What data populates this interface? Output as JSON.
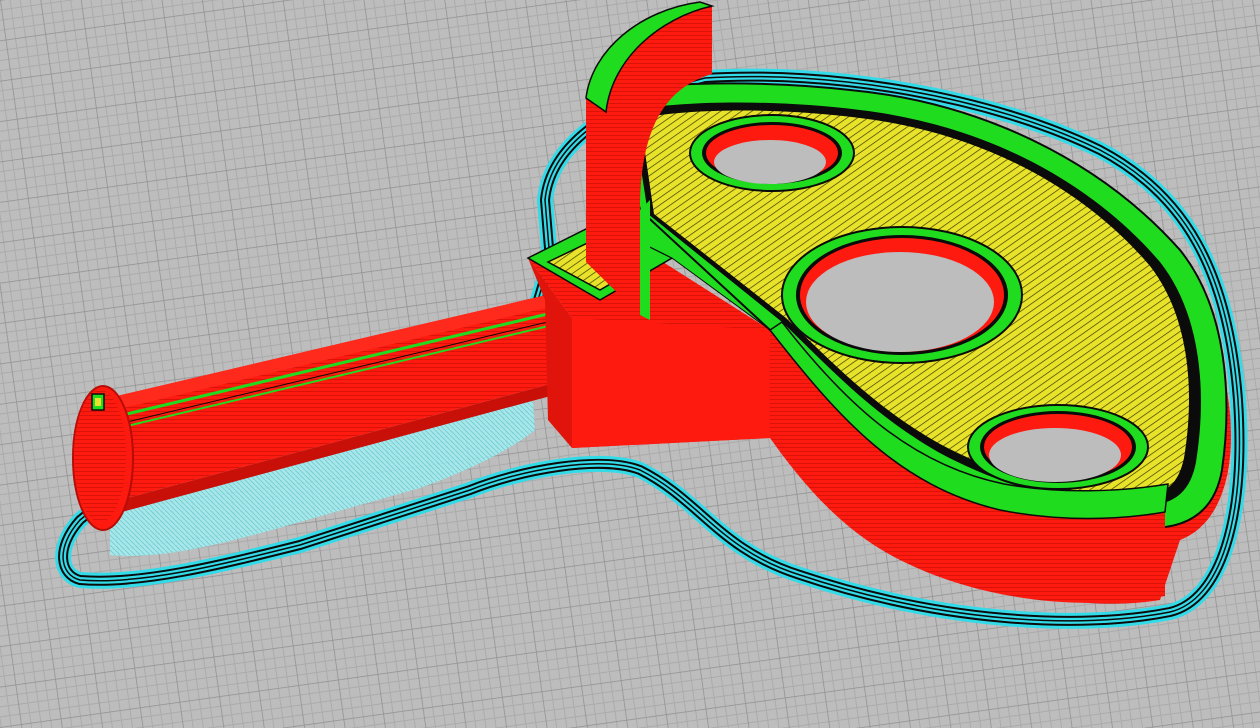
{
  "viewport": {
    "view": "layer-preview",
    "colors": {
      "bed": "#bdbdbd",
      "grid_minor": "#a9a9a9",
      "grid_major": "#8e8e8e",
      "skirt": "#33dbe8",
      "support": "#8fe6ea",
      "outer_wall": "#ff1a10",
      "wall_dark": "#b80c06",
      "inner_wall": "#1fdc1f",
      "infill": "#e8e32a",
      "line_separator": "#0b0b0b"
    }
  }
}
